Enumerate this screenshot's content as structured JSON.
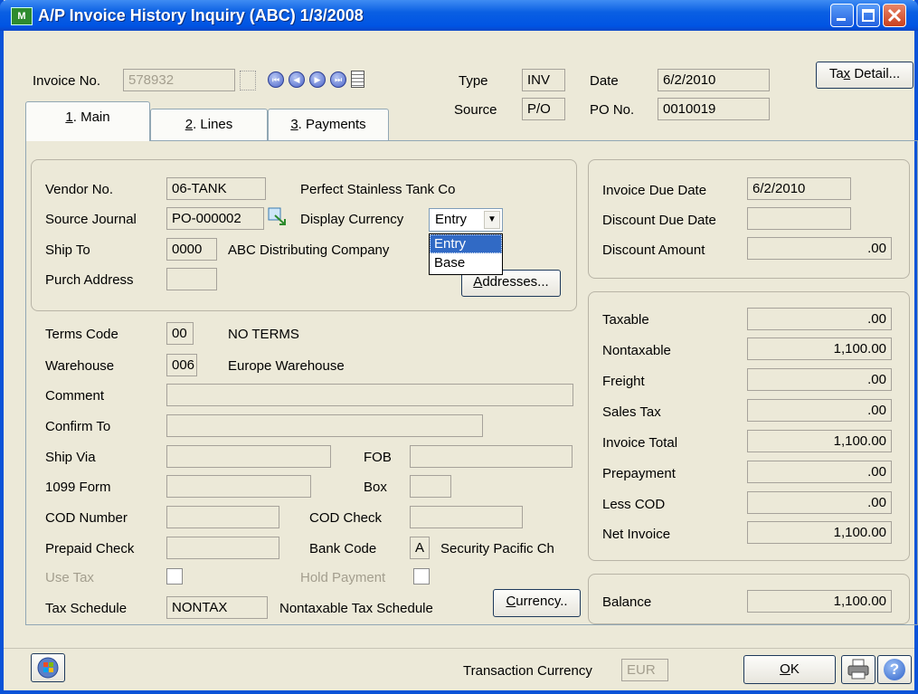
{
  "window": {
    "title": "A/P Invoice History Inquiry (ABC) 1/3/2008",
    "app_icon_text": "M"
  },
  "header": {
    "invoice_no_label": "Invoice No.",
    "invoice_no": "578932",
    "type_label": "Type",
    "type": "INV",
    "source_label": "Source",
    "source": "P/O",
    "date_label": "Date",
    "date": "6/2/2010",
    "po_no_label": "PO No.",
    "po_no": "0010019",
    "tax_detail_pre": "Ta",
    "tax_detail_u": "x",
    "tax_detail_post": " Detail..."
  },
  "tabs": [
    {
      "u": "1",
      "label": ". Main"
    },
    {
      "u": "2",
      "label": ". Lines"
    },
    {
      "u": "3",
      "label": ". Payments"
    }
  ],
  "vendor": {
    "vendor_no_label": "Vendor No.",
    "vendor_no": "06-TANK",
    "vendor_name": "Perfect Stainless Tank Co",
    "source_journal_label": "Source Journal",
    "source_journal": "PO-000002",
    "display_currency_label": "Display Currency",
    "display_currency": "Entry",
    "currency_options": [
      "Entry",
      "Base"
    ],
    "ship_to_label": "Ship To",
    "ship_to": "0000",
    "ship_to_name": "ABC Distributing Company",
    "purch_address_label": "Purch Address",
    "purch_address": "",
    "addresses_u": "A",
    "addresses_post": "ddresses..."
  },
  "details": {
    "terms_code_label": "Terms Code",
    "terms_code": "00",
    "terms_desc": "NO TERMS",
    "warehouse_label": "Warehouse",
    "warehouse": "006",
    "warehouse_desc": "Europe Warehouse",
    "comment_label": "Comment",
    "comment": "",
    "confirm_to_label": "Confirm To",
    "confirm_to": "",
    "ship_via_label": "Ship Via",
    "ship_via": "",
    "fob_label": "FOB",
    "fob": "",
    "form1099_label": "1099 Form",
    "form1099": "",
    "box_label": "Box",
    "box": "",
    "cod_number_label": "COD Number",
    "cod_number": "",
    "cod_check_label": "COD Check",
    "cod_check": "",
    "prepaid_check_label": "Prepaid Check",
    "prepaid_check": "",
    "bank_code_label": "Bank Code",
    "bank_code": "A",
    "bank_name": "Security Pacific Ch",
    "use_tax_label": "Use Tax",
    "hold_payment_label": "Hold Payment",
    "tax_schedule_label": "Tax Schedule",
    "tax_schedule": "NONTAX",
    "tax_schedule_desc": "Nontaxable Tax Schedule",
    "currency_u": "C",
    "currency_post": "urrency.."
  },
  "due": {
    "invoice_due_date_label": "Invoice Due Date",
    "invoice_due_date": "6/2/2010",
    "discount_due_date_label": "Discount Due Date",
    "discount_due_date": "",
    "discount_amount_label": "Discount Amount",
    "discount_amount": ".00"
  },
  "totals": [
    {
      "label": "Taxable",
      "value": ".00"
    },
    {
      "label": "Nontaxable",
      "value": "1,100.00"
    },
    {
      "label": "Freight",
      "value": ".00"
    },
    {
      "label": "Sales Tax",
      "value": ".00"
    },
    {
      "label": "Invoice Total",
      "value": "1,100.00"
    },
    {
      "label": "Prepayment",
      "value": ".00"
    },
    {
      "label": "Less COD",
      "value": ".00"
    },
    {
      "label": "Net Invoice",
      "value": "1,100.00"
    }
  ],
  "balance": {
    "label": "Balance",
    "value": "1,100.00"
  },
  "footer": {
    "transaction_currency_label": "Transaction Currency",
    "transaction_currency": "EUR",
    "ok_u": "O",
    "ok_post": "K"
  },
  "icons": {
    "help": "?",
    "nav_first": "⏮",
    "nav_prev": "◀",
    "nav_next": "▶",
    "nav_last": "⏭",
    "combo_arrow": "▼"
  }
}
